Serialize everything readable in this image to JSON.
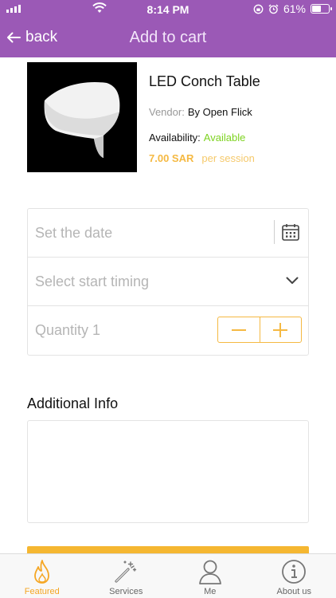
{
  "status_bar": {
    "time": "8:14 PM",
    "battery_text": "61%",
    "battery_level": 0.61
  },
  "nav": {
    "back_label": "back",
    "title": "Add to cart"
  },
  "product": {
    "name": "LED Conch Table",
    "vendor_label": "Vendor:",
    "vendor_value": "By Open Flick",
    "availability_label": "Availability:",
    "availability_value": "Available",
    "price": "7.00 SAR",
    "price_unit": "per session"
  },
  "form": {
    "date_placeholder": "Set the date",
    "timing_placeholder": "Select start timing",
    "quantity_text": "Quantity 1"
  },
  "additional": {
    "label": "Additional Info",
    "value": ""
  },
  "tabs": [
    {
      "label": "Featured",
      "icon": "flame-icon",
      "active": true
    },
    {
      "label": "Services",
      "icon": "magic-wand-icon",
      "active": false
    },
    {
      "label": "Me",
      "icon": "user-icon",
      "active": false
    },
    {
      "label": "About us",
      "icon": "info-icon",
      "active": false
    }
  ],
  "colors": {
    "nav_purple": "#9b59b6",
    "accent_orange": "#f5b942",
    "available_green": "#7ed321"
  }
}
